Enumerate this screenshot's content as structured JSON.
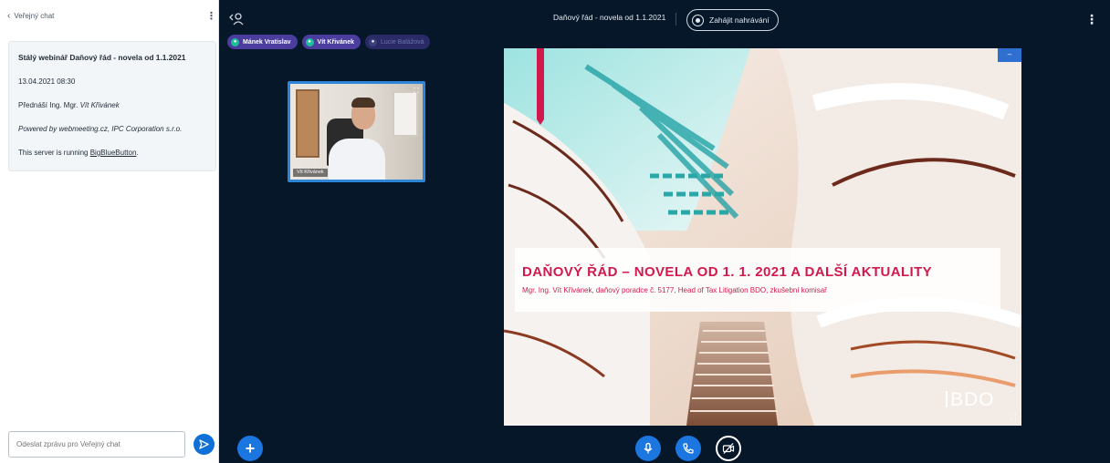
{
  "chat": {
    "back_label": "Veřejný chat",
    "welcome": {
      "title": "Stálý webinář Daňový řád - novela od 1.1.2021",
      "datetime": "13.04.2021 08:30",
      "lecturer_prefix": "Přednáší Ing. Mgr. ",
      "lecturer_name": "Vít Křivánek",
      "powered_by": "Powered by webmeeting.cz, IPC Corporation s.r.o.",
      "server_prefix": "This server is running ",
      "server_link": "BigBlueButton",
      "server_suffix": "."
    },
    "input_placeholder": "Odeslat zprávu pro Veřejný chat"
  },
  "header": {
    "meeting_title": "Daňový řád - novela od 1.1.2021",
    "record_label": "Zahájit nahrávání"
  },
  "talkers": [
    {
      "name": "Mánek Vratislav",
      "state": "active"
    },
    {
      "name": "Vít Křivánek",
      "state": "active"
    },
    {
      "name": "Lucie Balážová",
      "state": "muted"
    }
  ],
  "webcam": {
    "name": "Vít Křivánek"
  },
  "slide": {
    "title": "DAŇOVÝ ŘÁD – NOVELA OD 1. 1. 2021 A DALŠÍ AKTUALITY",
    "subtitle": "Mgr. Ing. Vít Křivánek, daňový poradce č. 5177, Head of Tax Litigation BDO, zkušební komisař",
    "logo": "BDO",
    "accent_color": "#d2194d"
  },
  "colors": {
    "stage_bg": "#06172a",
    "primary": "#1b76e0"
  },
  "icons": {
    "back": "chevron-left-icon",
    "menu": "vertical-dots-icon",
    "send": "send-icon",
    "users": "users-icon",
    "record": "record-icon",
    "actions": "plus-icon",
    "mic": "microphone-icon",
    "phone": "phone-icon",
    "camera": "camera-off-icon"
  }
}
